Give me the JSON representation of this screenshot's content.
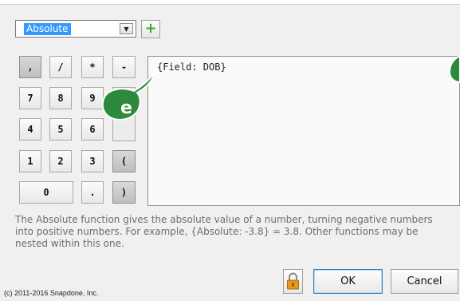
{
  "function_select": {
    "value": "Absolute"
  },
  "add_button": {
    "icon": "plus-icon",
    "color": "#3cab2a"
  },
  "keypad": {
    "comma": ",",
    "slash": "/",
    "asterisk": "*",
    "minus": "-",
    "seven": "7",
    "eight": "8",
    "nine": "9",
    "four": "4",
    "five": "5",
    "six": "6",
    "one": "1",
    "two": "2",
    "three": "3",
    "open_paren": "(",
    "zero": "0",
    "dot": ".",
    "close_paren": ")"
  },
  "expression": {
    "text": "{Field: DOB}"
  },
  "callout": {
    "letter": "e",
    "color": "#2d8a3c"
  },
  "description": "The Absolute function gives the absolute value of a number, turning negative numbers into positive numbers.  For example, {Absolute: -3.8} = 3.8.  Other functions may be nested within this one.",
  "footer": {
    "copyright": "(c) 2011-2016 Snapdone, Inc.",
    "ok_label": "OK",
    "cancel_label": "Cancel",
    "lock_icon": "lock-icon"
  }
}
